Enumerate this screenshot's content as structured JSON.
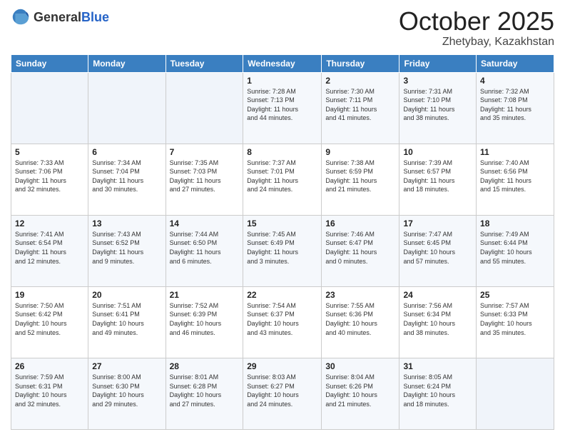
{
  "header": {
    "logo_general": "General",
    "logo_blue": "Blue",
    "month": "October 2025",
    "location": "Zhetybay, Kazakhstan"
  },
  "days_of_week": [
    "Sunday",
    "Monday",
    "Tuesday",
    "Wednesday",
    "Thursday",
    "Friday",
    "Saturday"
  ],
  "weeks": [
    [
      {
        "day": "",
        "info": ""
      },
      {
        "day": "",
        "info": ""
      },
      {
        "day": "",
        "info": ""
      },
      {
        "day": "1",
        "info": "Sunrise: 7:28 AM\nSunset: 7:13 PM\nDaylight: 11 hours\nand 44 minutes."
      },
      {
        "day": "2",
        "info": "Sunrise: 7:30 AM\nSunset: 7:11 PM\nDaylight: 11 hours\nand 41 minutes."
      },
      {
        "day": "3",
        "info": "Sunrise: 7:31 AM\nSunset: 7:10 PM\nDaylight: 11 hours\nand 38 minutes."
      },
      {
        "day": "4",
        "info": "Sunrise: 7:32 AM\nSunset: 7:08 PM\nDaylight: 11 hours\nand 35 minutes."
      }
    ],
    [
      {
        "day": "5",
        "info": "Sunrise: 7:33 AM\nSunset: 7:06 PM\nDaylight: 11 hours\nand 32 minutes."
      },
      {
        "day": "6",
        "info": "Sunrise: 7:34 AM\nSunset: 7:04 PM\nDaylight: 11 hours\nand 30 minutes."
      },
      {
        "day": "7",
        "info": "Sunrise: 7:35 AM\nSunset: 7:03 PM\nDaylight: 11 hours\nand 27 minutes."
      },
      {
        "day": "8",
        "info": "Sunrise: 7:37 AM\nSunset: 7:01 PM\nDaylight: 11 hours\nand 24 minutes."
      },
      {
        "day": "9",
        "info": "Sunrise: 7:38 AM\nSunset: 6:59 PM\nDaylight: 11 hours\nand 21 minutes."
      },
      {
        "day": "10",
        "info": "Sunrise: 7:39 AM\nSunset: 6:57 PM\nDaylight: 11 hours\nand 18 minutes."
      },
      {
        "day": "11",
        "info": "Sunrise: 7:40 AM\nSunset: 6:56 PM\nDaylight: 11 hours\nand 15 minutes."
      }
    ],
    [
      {
        "day": "12",
        "info": "Sunrise: 7:41 AM\nSunset: 6:54 PM\nDaylight: 11 hours\nand 12 minutes."
      },
      {
        "day": "13",
        "info": "Sunrise: 7:43 AM\nSunset: 6:52 PM\nDaylight: 11 hours\nand 9 minutes."
      },
      {
        "day": "14",
        "info": "Sunrise: 7:44 AM\nSunset: 6:50 PM\nDaylight: 11 hours\nand 6 minutes."
      },
      {
        "day": "15",
        "info": "Sunrise: 7:45 AM\nSunset: 6:49 PM\nDaylight: 11 hours\nand 3 minutes."
      },
      {
        "day": "16",
        "info": "Sunrise: 7:46 AM\nSunset: 6:47 PM\nDaylight: 11 hours\nand 0 minutes."
      },
      {
        "day": "17",
        "info": "Sunrise: 7:47 AM\nSunset: 6:45 PM\nDaylight: 10 hours\nand 57 minutes."
      },
      {
        "day": "18",
        "info": "Sunrise: 7:49 AM\nSunset: 6:44 PM\nDaylight: 10 hours\nand 55 minutes."
      }
    ],
    [
      {
        "day": "19",
        "info": "Sunrise: 7:50 AM\nSunset: 6:42 PM\nDaylight: 10 hours\nand 52 minutes."
      },
      {
        "day": "20",
        "info": "Sunrise: 7:51 AM\nSunset: 6:41 PM\nDaylight: 10 hours\nand 49 minutes."
      },
      {
        "day": "21",
        "info": "Sunrise: 7:52 AM\nSunset: 6:39 PM\nDaylight: 10 hours\nand 46 minutes."
      },
      {
        "day": "22",
        "info": "Sunrise: 7:54 AM\nSunset: 6:37 PM\nDaylight: 10 hours\nand 43 minutes."
      },
      {
        "day": "23",
        "info": "Sunrise: 7:55 AM\nSunset: 6:36 PM\nDaylight: 10 hours\nand 40 minutes."
      },
      {
        "day": "24",
        "info": "Sunrise: 7:56 AM\nSunset: 6:34 PM\nDaylight: 10 hours\nand 38 minutes."
      },
      {
        "day": "25",
        "info": "Sunrise: 7:57 AM\nSunset: 6:33 PM\nDaylight: 10 hours\nand 35 minutes."
      }
    ],
    [
      {
        "day": "26",
        "info": "Sunrise: 7:59 AM\nSunset: 6:31 PM\nDaylight: 10 hours\nand 32 minutes."
      },
      {
        "day": "27",
        "info": "Sunrise: 8:00 AM\nSunset: 6:30 PM\nDaylight: 10 hours\nand 29 minutes."
      },
      {
        "day": "28",
        "info": "Sunrise: 8:01 AM\nSunset: 6:28 PM\nDaylight: 10 hours\nand 27 minutes."
      },
      {
        "day": "29",
        "info": "Sunrise: 8:03 AM\nSunset: 6:27 PM\nDaylight: 10 hours\nand 24 minutes."
      },
      {
        "day": "30",
        "info": "Sunrise: 8:04 AM\nSunset: 6:26 PM\nDaylight: 10 hours\nand 21 minutes."
      },
      {
        "day": "31",
        "info": "Sunrise: 8:05 AM\nSunset: 6:24 PM\nDaylight: 10 hours\nand 18 minutes."
      },
      {
        "day": "",
        "info": ""
      }
    ]
  ]
}
